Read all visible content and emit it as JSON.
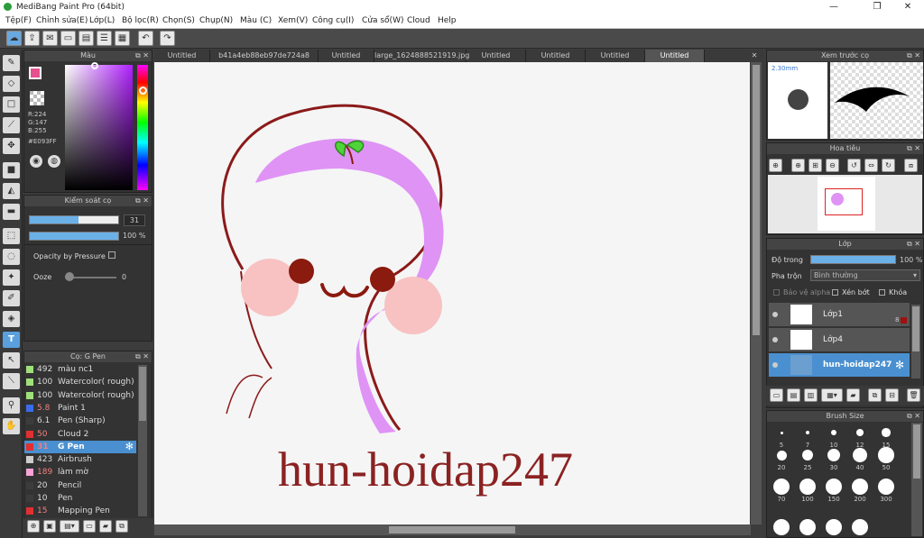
{
  "window": {
    "title": "MediBang Paint Pro (64bit)"
  },
  "menu": [
    "Tệp(F)",
    "Chỉnh sửa(E)",
    "Lớp(L)",
    "Bộ lọc(R)",
    "Chọn(S)",
    "Chụp(N)",
    "Màu (C)",
    "Xem(V)",
    "Công cụ(I)",
    "Cửa sổ(W)",
    "Cloud",
    "Help"
  ],
  "tabs": [
    "Untitled",
    "b41a4eb88eb97de724a8 (1).jpg",
    "Untitled",
    "large_1624888521919.jpg",
    "Untitled",
    "Untitled",
    "Untitled",
    "Untitled"
  ],
  "color_panel": {
    "title": "Màu",
    "r": "R:224",
    "g": "G:147",
    "b": "B:255",
    "hex": "#E093FF",
    "accent": "#e093ff"
  },
  "brush_control": {
    "title": "Kiểm soát cọ",
    "size": "31",
    "size_fill": 0.55,
    "opacity": "100 %",
    "opacity_fill": 1.0,
    "opacity_pressure": "Opacity by Pressure",
    "ooze_label": "Ooze",
    "ooze_value": "0"
  },
  "brush_list": {
    "title": "Cọ: G Pen",
    "items": [
      {
        "size": "492",
        "name": "màu nc1",
        "color": "#9fe07a"
      },
      {
        "size": "100",
        "name": "Watercolor( rough)",
        "color": "#9fe07a"
      },
      {
        "size": "100",
        "name": "Watercolor( rough)",
        "color": "#9fe07a"
      },
      {
        "size": "5.8",
        "name": "Paint 1",
        "color": "#3a6be8"
      },
      {
        "size": "6.1",
        "name": "Pen (Sharp)",
        "color": "#3c3c3c"
      },
      {
        "size": "50",
        "name": "Cloud 2",
        "color": "#e03030"
      },
      {
        "size": "31",
        "name": "G Pen",
        "color": "#e03030"
      },
      {
        "size": "423",
        "name": "Airbrush",
        "color": "#cccccc"
      },
      {
        "size": "189",
        "name": "làm mờ",
        "color": "#f7a3d8"
      },
      {
        "size": "20",
        "name": "Pencil",
        "color": "#3c3c3c"
      },
      {
        "size": "10",
        "name": "Pen",
        "color": "#3c3c3c"
      },
      {
        "size": "15",
        "name": "Mapping Pen",
        "color": "#e03030"
      }
    ],
    "selected_index": 6
  },
  "canvas": {
    "watermark": "hun-hoidap247"
  },
  "preview": {
    "title": "Xem trước cọ",
    "size": "2.30mm"
  },
  "navigator": {
    "title": "Hoa tiêu"
  },
  "layers": {
    "title": "Lớp",
    "opacity_label": "Độ trong",
    "opacity_value": "100 %",
    "blend_label": "Pha trộn",
    "blend_value": "Bình thường",
    "protect_alpha": "Bảo vệ alpha",
    "clipping": "Xén bớt",
    "lock": "Khóa",
    "items": [
      {
        "name": "Lớp1",
        "badge": "8"
      },
      {
        "name": "Lớp4",
        "badge": ""
      },
      {
        "name": "hun-hoidap247",
        "badge": ""
      }
    ],
    "selected_index": 2
  },
  "brush_size": {
    "title": "Brush Size",
    "sizes": [
      "5",
      "7",
      "10",
      "12",
      "15",
      "20",
      "25",
      "30",
      "40",
      "50",
      "70",
      "100",
      "150",
      "200",
      "300"
    ]
  }
}
